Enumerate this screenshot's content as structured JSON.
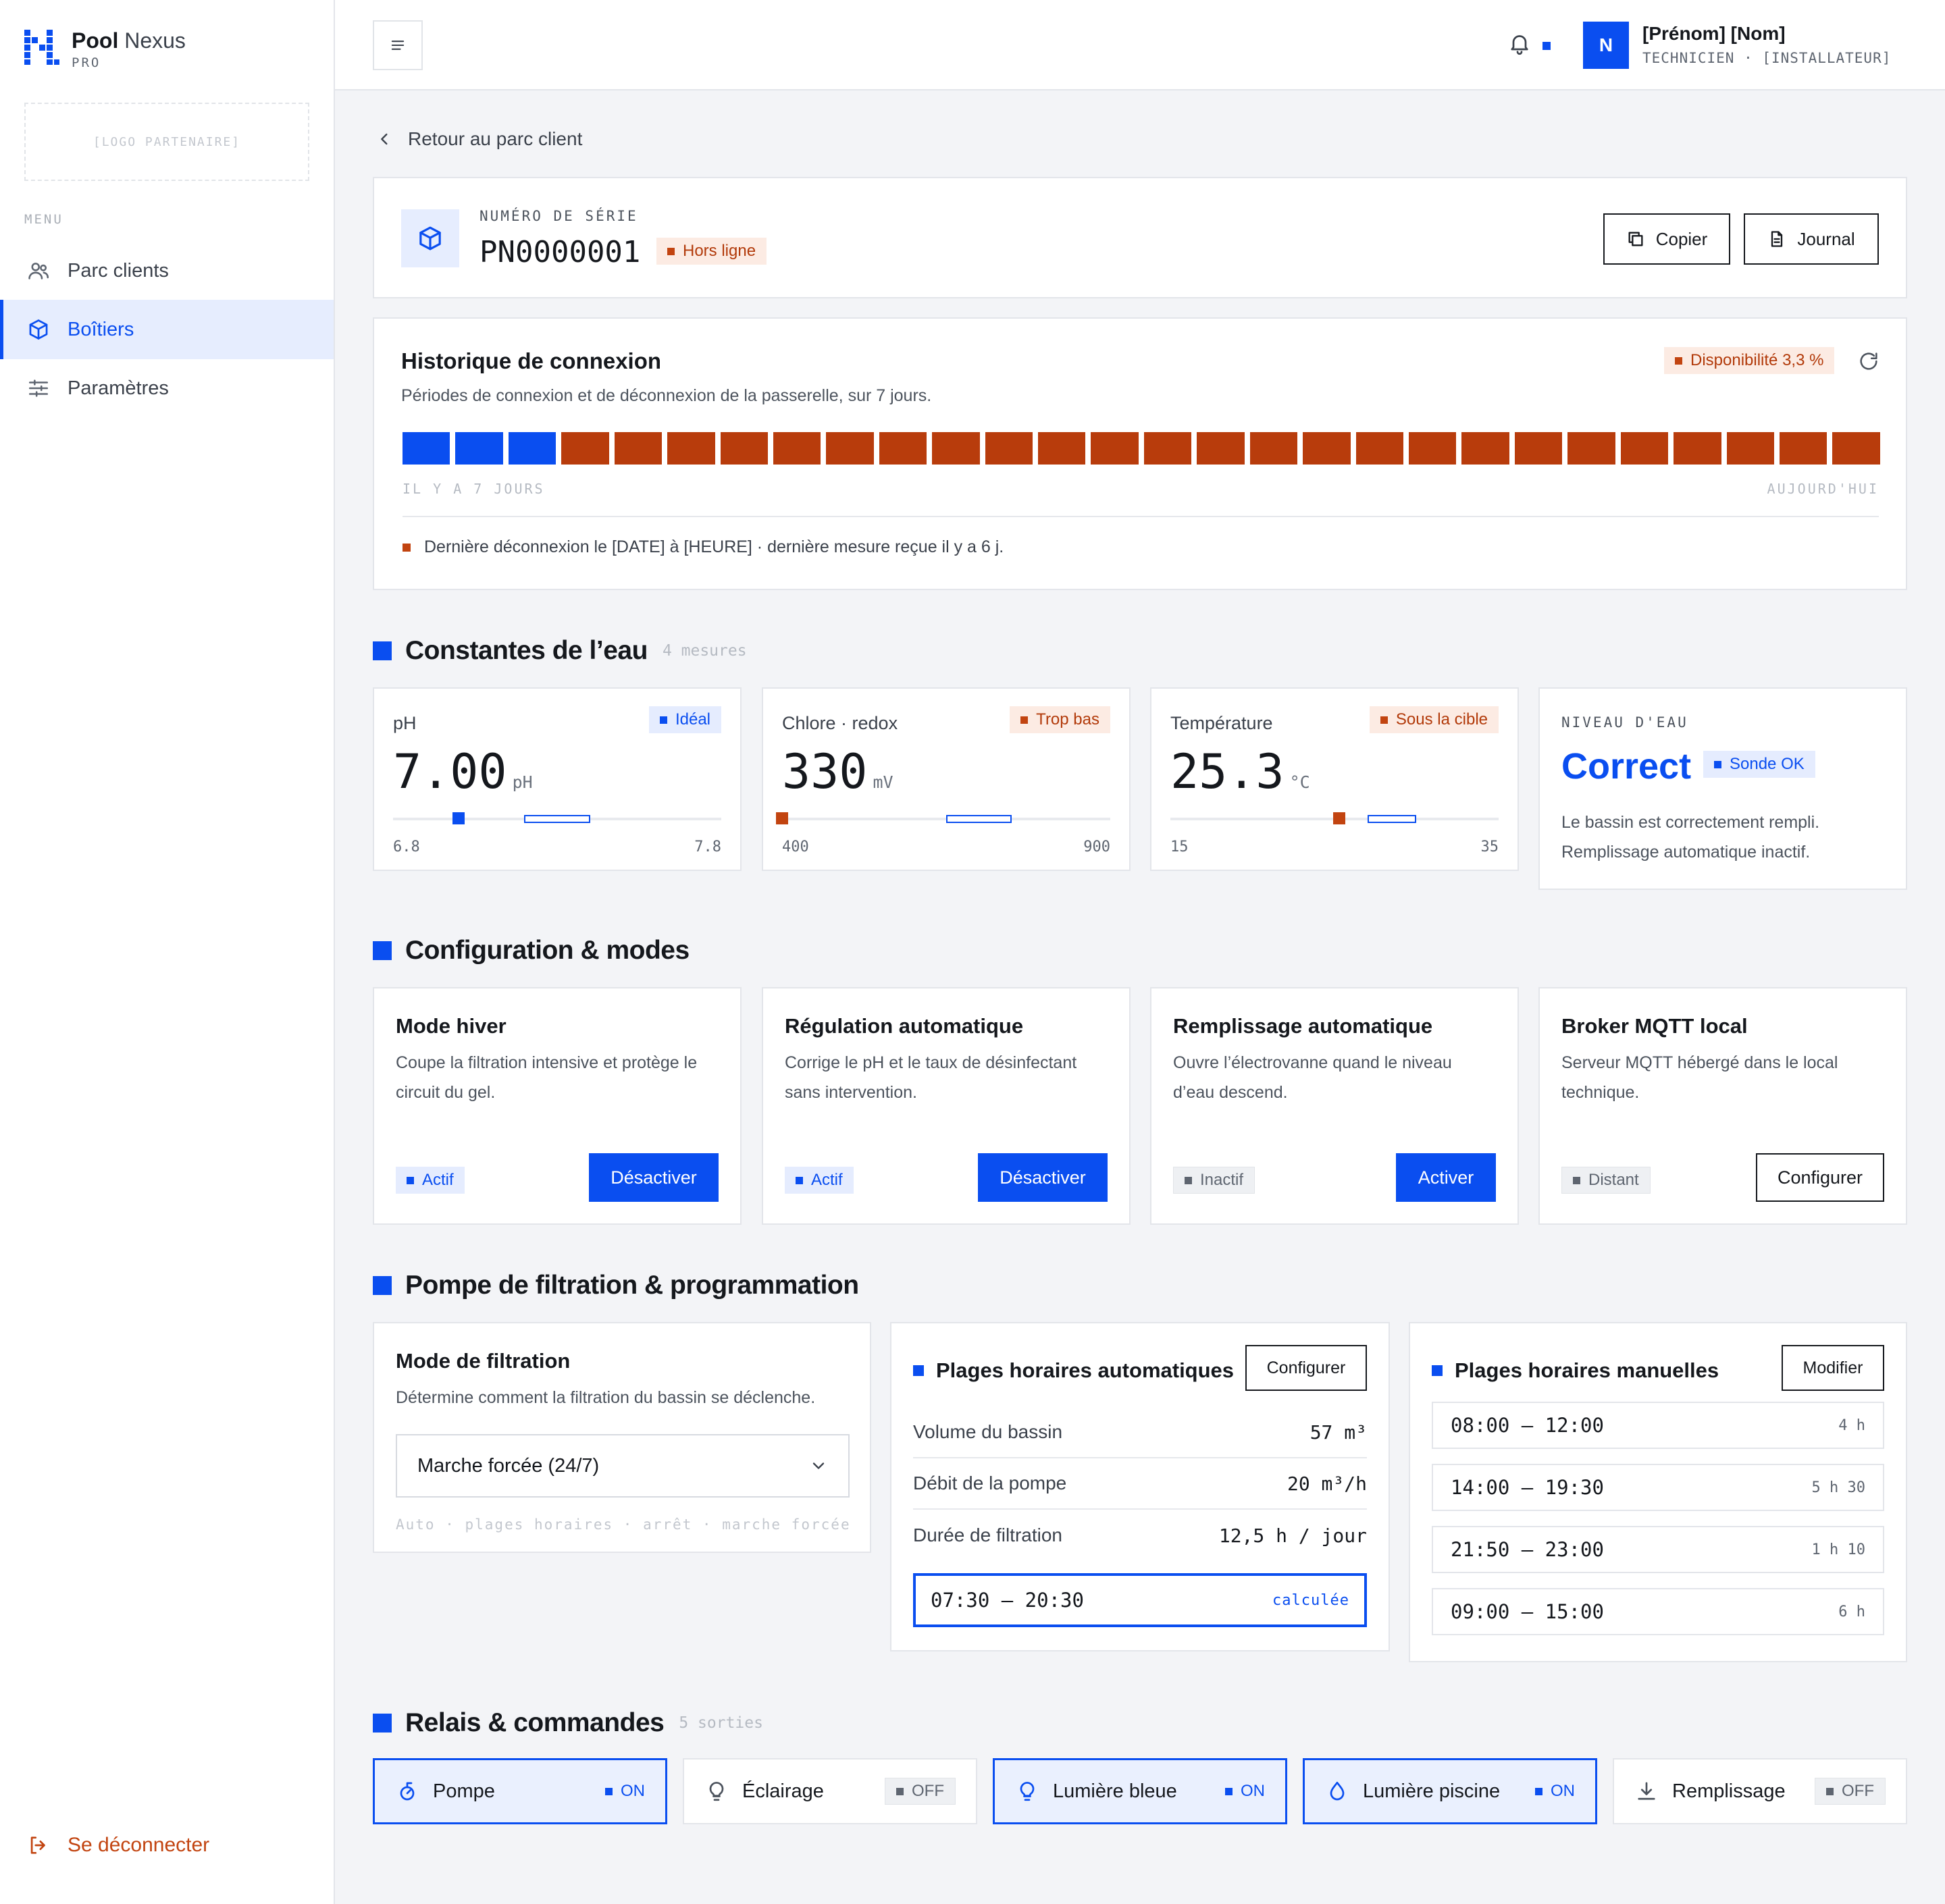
{
  "brand": {
    "name_bold": "Pool",
    "name_light": "Nexus",
    "tier": "PRO",
    "partner_logo": "[LOGO PARTENAIRE]"
  },
  "sidebar": {
    "menu_label": "MENU",
    "items": [
      {
        "label": "Parc clients",
        "icon": "users-icon",
        "active": false
      },
      {
        "label": "Boîtiers",
        "icon": "box-icon",
        "active": true
      },
      {
        "label": "Paramètres",
        "icon": "sliders-icon",
        "active": false
      }
    ],
    "logout": "Se déconnecter"
  },
  "header": {
    "avatar": "N",
    "user_name": "[Prénom] [Nom]",
    "user_role": "TECHNICIEN · [INSTALLATEUR]"
  },
  "back_link": "Retour au parc client",
  "device": {
    "serial_label": "NUMÉRO DE SÉRIE",
    "serial": "PN0000001",
    "status": "Hors ligne",
    "copy": "Copier",
    "log": "Journal"
  },
  "history": {
    "title": "Historique de connexion",
    "subtitle": "Périodes de connexion et de déconnexion de la passerelle, sur 7 jours.",
    "availability": "Disponibilité 3,3 %",
    "start_label": "IL Y A 7 JOURS",
    "end_label": "AUJOURD'HUI",
    "segments": [
      "on",
      "on",
      "on",
      "off",
      "off",
      "off",
      "off",
      "off",
      "off",
      "off",
      "off",
      "off",
      "off",
      "off",
      "off",
      "off",
      "off",
      "off",
      "off",
      "off",
      "off",
      "off",
      "off",
      "off",
      "off",
      "off",
      "off",
      "off"
    ],
    "note": "Dernière déconnexion le [DATE] à [HEURE] · dernière mesure reçue il y a 6 j.",
    "colors": {
      "on": "#0a4ef0",
      "off": "#b83c0c"
    }
  },
  "water": {
    "title": "Constantes de l’eau",
    "count": "4 mesures",
    "metrics": [
      {
        "label": "pH",
        "value": "7.00",
        "unit": "pH",
        "tag": "Idéal",
        "tag_kind": "ok",
        "min": "6.8",
        "max": "7.8",
        "min_v": 6.8,
        "max_v": 7.8,
        "current": 7.0,
        "target_lo": 7.2,
        "target_hi": 7.4
      },
      {
        "label": "Chlore · redox",
        "value": "330",
        "unit": "mV",
        "tag": "Trop bas",
        "tag_kind": "warn",
        "min": "400",
        "max": "900",
        "min_v": 400,
        "max_v": 900,
        "current": 400,
        "target_lo": 650,
        "target_hi": 750
      },
      {
        "label": "Température",
        "value": "25.3",
        "unit": "°C",
        "tag": "Sous la cible",
        "tag_kind": "warn",
        "min": "15",
        "max": "35",
        "min_v": 15,
        "max_v": 35,
        "current": 25.3,
        "target_lo": 27,
        "target_hi": 30
      }
    ],
    "level": {
      "label": "NIVEAU D'EAU",
      "value": "Correct",
      "tag": "Sonde OK",
      "desc": "Le bassin est correctement rempli. Remplissage automatique inactif."
    }
  },
  "config": {
    "title": "Configuration & modes",
    "cards": [
      {
        "title": "Mode hiver",
        "desc": "Coupe la filtration intensive et protège le circuit du gel.",
        "status": "Actif",
        "status_kind": "ok",
        "action": "Désactiver",
        "action_kind": "primary"
      },
      {
        "title": "Régulation automatique",
        "desc": "Corrige le pH et le taux de désinfectant sans intervention.",
        "status": "Actif",
        "status_kind": "ok",
        "action": "Désactiver",
        "action_kind": "primary"
      },
      {
        "title": "Remplissage automatique",
        "desc": "Ouvre l’électrovanne quand le niveau d’eau descend.",
        "status": "Inactif",
        "status_kind": "mute",
        "action": "Activer",
        "action_kind": "primary"
      },
      {
        "title": "Broker MQTT local",
        "desc": "Serveur MQTT hébergé dans le local technique.",
        "status": "Distant",
        "status_kind": "mute",
        "action": "Configurer",
        "action_kind": "outline"
      }
    ]
  },
  "pump": {
    "title": "Pompe de filtration & programmation",
    "mode": {
      "title": "Mode de filtration",
      "desc": "Détermine comment la filtration du bassin se déclenche.",
      "selected": "Marche forcée (24/7)",
      "hint": "Auto · plages horaires · arrêt · marche forcée"
    },
    "auto": {
      "title": "Plages horaires automatiques",
      "action": "Configurer",
      "rows": [
        {
          "k": "Volume du bassin",
          "v": "57 m³"
        },
        {
          "k": "Débit de la pompe",
          "v": "20 m³/h"
        },
        {
          "k": "Durée de filtration",
          "v": "12,5 h / jour"
        }
      ],
      "computed_range": "07:30 – 20:30",
      "computed_label": "calculée"
    },
    "manual": {
      "title": "Plages horaires manuelles",
      "action": "Modifier",
      "slots": [
        {
          "range": "08:00 – 12:00",
          "dur": "4 h"
        },
        {
          "range": "14:00 – 19:30",
          "dur": "5 h 30"
        },
        {
          "range": "21:50 – 23:00",
          "dur": "1 h 10"
        },
        {
          "range": "09:00 – 15:00",
          "dur": "6 h"
        }
      ]
    }
  },
  "relays": {
    "title": "Relais & commandes",
    "count": "5 sorties",
    "items": [
      {
        "label": "Pompe",
        "state": "ON",
        "icon": "pump-icon"
      },
      {
        "label": "Éclairage",
        "state": "OFF",
        "icon": "bulb-icon"
      },
      {
        "label": "Lumière bleue",
        "state": "ON",
        "icon": "bulb-icon"
      },
      {
        "label": "Lumière piscine",
        "state": "ON",
        "icon": "drop-icon"
      },
      {
        "label": "Remplissage",
        "state": "OFF",
        "icon": "download-icon"
      }
    ]
  },
  "accent": "#0a4ef0",
  "warn_color": "#c24410"
}
